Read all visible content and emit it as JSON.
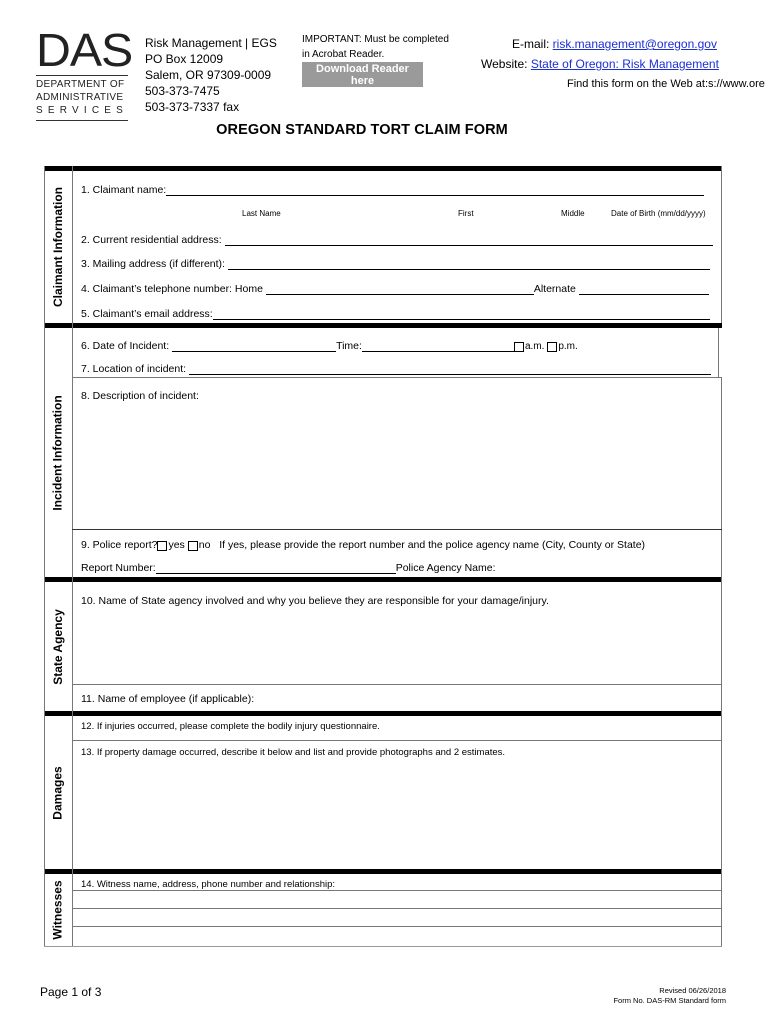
{
  "header": {
    "logo": {
      "acronym": "DAS",
      "line1": "DEPARTMENT OF",
      "line2": "ADMINISTRATIVE",
      "line3": "SERVICES"
    },
    "address": {
      "line1": "Risk Management | EGS",
      "line2": "PO Box 12009",
      "line3": "Salem, OR 97309-0009",
      "phone": "503-373-7475",
      "fax": "503-373-7337 fax"
    },
    "important": {
      "line1": "IMPORTANT: Must be completed",
      "line2": "in Acrobat Reader.",
      "download_button": "Download Reader here"
    },
    "contact": {
      "email_label": "E-mail: ",
      "email": "risk.management@oregon.gov",
      "website_label": "Website: ",
      "website": "State of Oregon: Risk Management",
      "find_text": "Find this form on the Web at:s://www.ore"
    },
    "link_color": "#1a2fd6"
  },
  "title": "OREGON STANDARD TORT CLAIM FORM",
  "sections": {
    "claimant": {
      "label": "Claimant Information",
      "q1": "1.    Claimant name:",
      "q1_sub": {
        "last": "Last Name",
        "first": "First",
        "middle": "Middle",
        "dob": "Date of Birth (mm/dd/yyyy)"
      },
      "q2": "2.  Current residential address:",
      "q3": "3.  Mailing address (if different):",
      "q4": "4.  Claimant’s telephone number: Home",
      "q4_alt": "Alternate",
      "q5": "5.  Claimant’s email address:"
    },
    "incident": {
      "label": "Incident Information",
      "q6": "6.  Date of Incident:",
      "q6_time": "Time:",
      "am": "a.m.",
      "pm": "p.m.",
      "q7": "7.  Location of incident:",
      "q8": "8. Description of incident:",
      "q9": "9.  Police report?",
      "yes": "yes",
      "no": "no",
      "q9_text": "If yes, please provide the report number and the police agency name (City, County or State)",
      "report_number": "Report Number:",
      "police_agency": "Police Agency Name:"
    },
    "state_agency": {
      "label": "State Agency",
      "q10": "10.  Name of State agency involved and why you believe they are responsible for your damage/injury.",
      "q11": "11.  Name of employee (if applicable):"
    },
    "damages": {
      "label": "Damages",
      "q12": "12.  If injuries occurred, please complete the bodily injury questionnaire.",
      "q13": "13. If property damage occurred, describe it below and list and provide photographs and 2 estimates."
    },
    "witnesses": {
      "label": "Witnesses",
      "q14": "14. Witness name, address, phone number and relationship:"
    }
  },
  "footer": {
    "page": "Page 1 of 3",
    "revised": "Revised 06/26/2018",
    "form_no": "Form No. DAS-RM Standard form"
  }
}
